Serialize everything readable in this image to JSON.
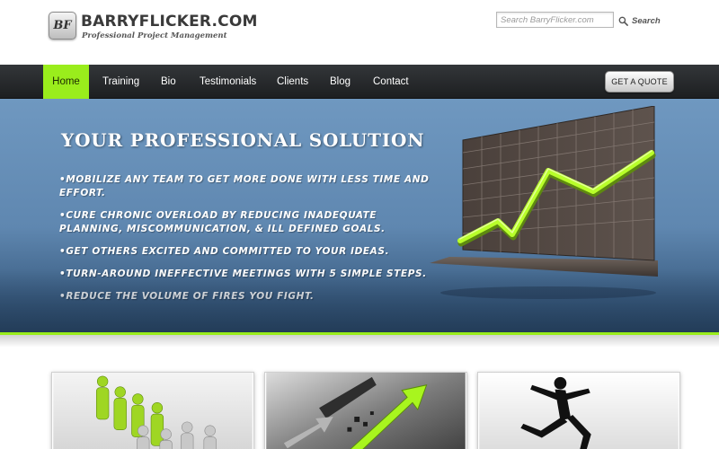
{
  "header": {
    "logo_initials": "BF",
    "site_name": "BARRYFLICKER.COM",
    "tagline": "Professional Project Management",
    "search_placeholder": "Search BarryFlicker.com",
    "search_label": "Search"
  },
  "nav": {
    "items": [
      {
        "label": "Home",
        "active": true
      },
      {
        "label": "Training",
        "active": false
      },
      {
        "label": "Bio",
        "active": false
      },
      {
        "label": "Testimonials",
        "active": false
      },
      {
        "label": "Clients",
        "active": false
      },
      {
        "label": "Blog",
        "active": false
      },
      {
        "label": "Contact",
        "active": false
      }
    ],
    "quote_button": "GET A QUOTE"
  },
  "hero": {
    "title": "YOUR PROFESSIONAL SOLUTION",
    "bullets": [
      "MOBILIZE ANY TEAM TO GET MORE DONE WITH LESS TIME AND EFFORT.",
      "CURE CHRONIC OVERLOAD BY REDUCING INADEQUATE PLANNING, MISCOMMUNICATION, & ILL DEFINED GOALS.",
      "GET OTHERS EXCITED AND COMMITTED TO YOUR IDEAS.",
      "TURN-AROUND INEFFECTIVE MEETINGS WITH 5 SIMPLE STEPS.",
      "REDUCE THE VOLUME OF FIRES YOU FIGHT."
    ]
  },
  "colors": {
    "accent_green": "#9aed1c",
    "nav_dark": "#1d1f21",
    "hero_blue": "#5f87b0"
  },
  "icons": {
    "search": "magnifier-icon"
  }
}
